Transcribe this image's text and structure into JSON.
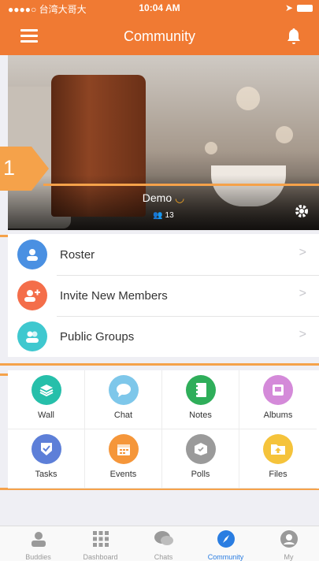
{
  "status": {
    "carrier": "●●●●○ 台湾大哥大",
    "wifi": "WiFi",
    "time": "10:04 AM"
  },
  "nav": {
    "title": "Community",
    "menu_icon": "hamburger-icon",
    "bell_icon": "bell-icon"
  },
  "hero": {
    "name": "Demo",
    "member_count": "13",
    "callout_number": "1"
  },
  "menu": [
    {
      "label": "Roster",
      "icon": "user-icon",
      "color": "#4a90e2"
    },
    {
      "label": "Invite New Members",
      "icon": "add-user-icon",
      "color": "#f46e4a"
    },
    {
      "label": "Public Groups",
      "icon": "group-icon",
      "color": "#3fc8cf"
    }
  ],
  "grid": [
    {
      "label": "Wall",
      "icon": "layers-icon",
      "color": "#26bfaa"
    },
    {
      "label": "Chat",
      "icon": "chat-bubble-icon",
      "color": "#7ec7ea"
    },
    {
      "label": "Notes",
      "icon": "notebook-icon",
      "color": "#2fae5a"
    },
    {
      "label": "Albums",
      "icon": "album-icon",
      "color": "#d48ad9"
    },
    {
      "label": "Tasks",
      "icon": "check-shield-icon",
      "color": "#5d7fd8"
    },
    {
      "label": "Events",
      "icon": "calendar-icon",
      "color": "#f5963a"
    },
    {
      "label": "Polls",
      "icon": "ballot-box-icon",
      "color": "#9a9a9a"
    },
    {
      "label": "Files",
      "icon": "folder-icon",
      "color": "#f5c33b"
    }
  ],
  "tabs": [
    {
      "label": "Buddies",
      "icon": "person-icon"
    },
    {
      "label": "Dashboard",
      "icon": "grid-icon"
    },
    {
      "label": "Chats",
      "icon": "chat-icon"
    },
    {
      "label": "Community",
      "icon": "compass-icon",
      "active": true
    },
    {
      "label": "My",
      "icon": "profile-icon"
    }
  ],
  "colors": {
    "brand": "#f07a33",
    "accent": "#2a7de1",
    "annotation": "#f5a24a"
  }
}
